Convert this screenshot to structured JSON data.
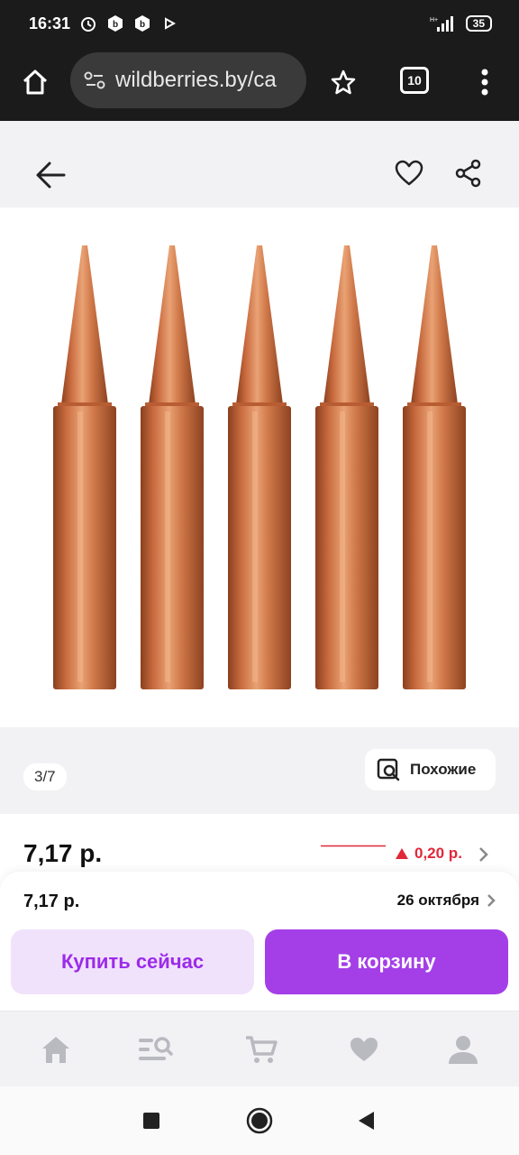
{
  "status_bar": {
    "time": "16:31",
    "battery": "35",
    "icons": [
      "alarm-icon",
      "b-badge-icon",
      "b-badge-icon",
      "play-icon",
      "signal-icon",
      "battery-icon"
    ]
  },
  "browser": {
    "url": "wildberries.by/ca",
    "tab_count": "10",
    "icons": [
      "home-icon",
      "site-settings-icon",
      "star-icon",
      "more-vert-icon"
    ]
  },
  "product": {
    "icons": [
      "back-arrow-icon",
      "heart-icon",
      "share-icon"
    ],
    "image_counter": "3/7",
    "similar_label": "Похожие",
    "price": "7,17 р.",
    "price_change": "0,20 р."
  },
  "purchase": {
    "price": "7,17 р.",
    "delivery_date": "26 октября",
    "buy_now_label": "Купить сейчас",
    "add_to_cart_label": "В корзину"
  },
  "bottom_nav": {
    "items": [
      "home-icon",
      "catalog-search-icon",
      "cart-icon",
      "favorites-icon",
      "profile-icon"
    ]
  },
  "android_nav": {
    "items": [
      "recents-icon",
      "home-circle-icon",
      "back-triangle-icon"
    ]
  },
  "colors": {
    "brand_purple": "#a43fe8",
    "buy_now_bg": "#f1e2fc",
    "price_up_red": "#e0283a",
    "copper": "#c86a3e"
  }
}
